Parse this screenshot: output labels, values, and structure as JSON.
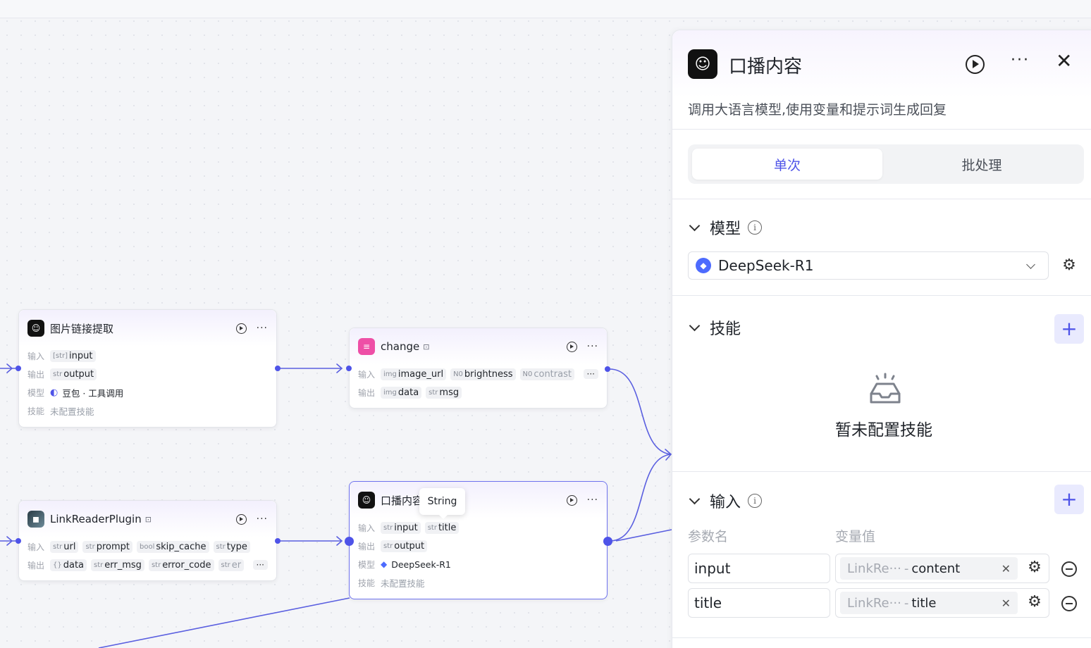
{
  "canvas": {
    "nodes": {
      "image_link": {
        "title": "图片链接提取",
        "input_label": "输入",
        "input_tags": [
          {
            "type": "[str]",
            "name": "input"
          }
        ],
        "output_label": "输出",
        "output_tags": [
          {
            "type": "str",
            "name": "output"
          }
        ],
        "model_label": "模型",
        "model_value": "豆包 · 工具调用",
        "skill_label": "技能",
        "skill_value": "未配置技能"
      },
      "change": {
        "title": "change",
        "input_label": "输入",
        "input_tags": [
          {
            "type": "img",
            "name": "image_url"
          },
          {
            "type": "N0",
            "name": "brightness"
          },
          {
            "type": "N0",
            "name": "contrast"
          }
        ],
        "more": "···",
        "output_label": "输出",
        "output_tags": [
          {
            "type": "img",
            "name": "data"
          },
          {
            "type": "str",
            "name": "msg"
          }
        ]
      },
      "link_reader": {
        "title": "LinkReaderPlugin",
        "input_label": "输入",
        "input_tags": [
          {
            "type": "str",
            "name": "url"
          },
          {
            "type": "str",
            "name": "prompt"
          },
          {
            "type": "bool",
            "name": "skip_cache"
          },
          {
            "type": "str",
            "name": "type"
          }
        ],
        "output_label": "输出",
        "output_tags": [
          {
            "type": "{}",
            "name": "data"
          },
          {
            "type": "str",
            "name": "err_msg"
          },
          {
            "type": "str",
            "name": "error_code"
          },
          {
            "type": "str",
            "name": "er"
          }
        ],
        "more": "···"
      },
      "broadcast": {
        "title": "口播内容",
        "input_label": "输入",
        "input_tags": [
          {
            "type": "str",
            "name": "input"
          },
          {
            "type": "str",
            "name": "title"
          }
        ],
        "output_label": "输出",
        "output_tags": [
          {
            "type": "str",
            "name": "output"
          }
        ],
        "model_label": "模型",
        "model_value": "DeepSeek-R1",
        "skill_label": "技能",
        "skill_value": "未配置技能"
      }
    },
    "tooltip": "String"
  },
  "panel": {
    "title": "口播内容",
    "description": "调用大语言模型,使用变量和提示词生成回复",
    "tabs": [
      {
        "label": "单次",
        "active": true
      },
      {
        "label": "批处理",
        "active": false
      }
    ],
    "model_section": {
      "title": "模型",
      "selected_model": "DeepSeek-R1"
    },
    "skill_section": {
      "title": "技能",
      "empty_text": "暂未配置技能"
    },
    "input_section": {
      "title": "输入",
      "col_param": "参数名",
      "col_value": "变量值",
      "rows": [
        {
          "param": "input",
          "source": "LinkRe···",
          "separator": "-",
          "field": "content"
        },
        {
          "param": "title",
          "source": "LinkRe···",
          "separator": "-",
          "field": "title"
        }
      ]
    }
  },
  "colors": {
    "accent": "#4e53e8",
    "edge": "#5a5fe0",
    "pink_icon": "#ee4fa6"
  }
}
